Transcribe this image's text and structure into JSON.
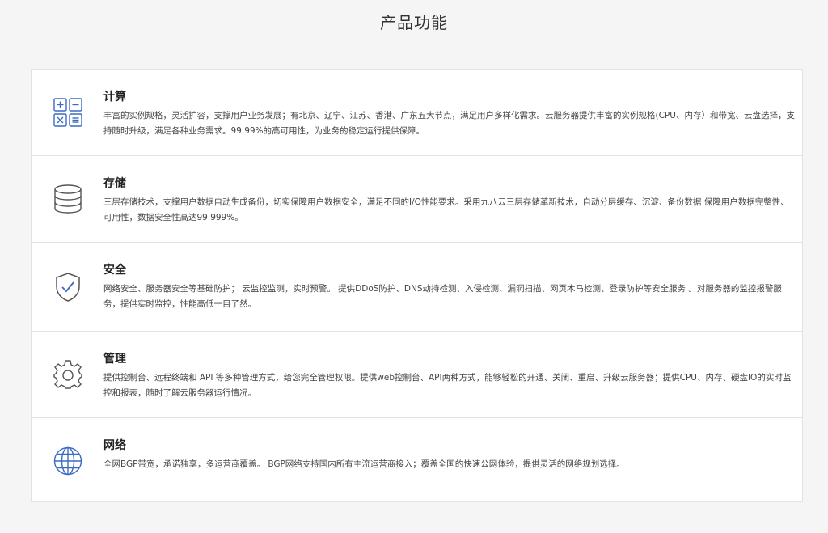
{
  "page": {
    "title": "产品功能"
  },
  "features": [
    {
      "icon": "calculator-icon",
      "title": "计算",
      "description": "丰富的实例规格，灵活扩容，支撑用户业务发展；有北京、辽宁、江苏、香港、广东五大节点，满足用户多样化需求。云服务器提供丰富的实例规格(CPU、内存）和带宽、云盘选择，支持随时升级，满足各种业务需求。99.99%的高可用性，为业务的稳定运行提供保障。"
    },
    {
      "icon": "database-icon",
      "title": "存储",
      "description": "三层存储技术，支撑用户数据自动生成备份，切实保障用户数据安全，满足不同的I/O性能要求。采用九八云三层存储革新技术，自动分层缓存、沉淀、备份数据 保障用户数据完整性、可用性，数据安全性高达99.999%。"
    },
    {
      "icon": "shield-check-icon",
      "title": "安全",
      "description": "网络安全、服务器安全等基础防护； 云监控监测，实时预警。 提供DDoS防护、DNS劫持检测、入侵检测、漏洞扫描、网页木马检测、登录防护等安全服务 。对服务器的监控报警服务，提供实时监控，性能高低一目了然。"
    },
    {
      "icon": "gear-icon",
      "title": "管理",
      "description": "提供控制台、远程终端和 API 等多种管理方式，给您完全管理权限。提供web控制台、API两种方式，能够轻松的开通、关闭、重启、升级云服务器；提供CPU、内存、硬盘IO的实时监控和报表，随时了解云服务器运行情况。"
    },
    {
      "icon": "globe-icon",
      "title": "网络",
      "description": "全网BGP带宽，承诺独享，多运营商覆盖。 BGP网络支持国内所有主流运营商接入；覆盖全国的快速公网体验，提供灵活的网络规划选择。"
    }
  ]
}
